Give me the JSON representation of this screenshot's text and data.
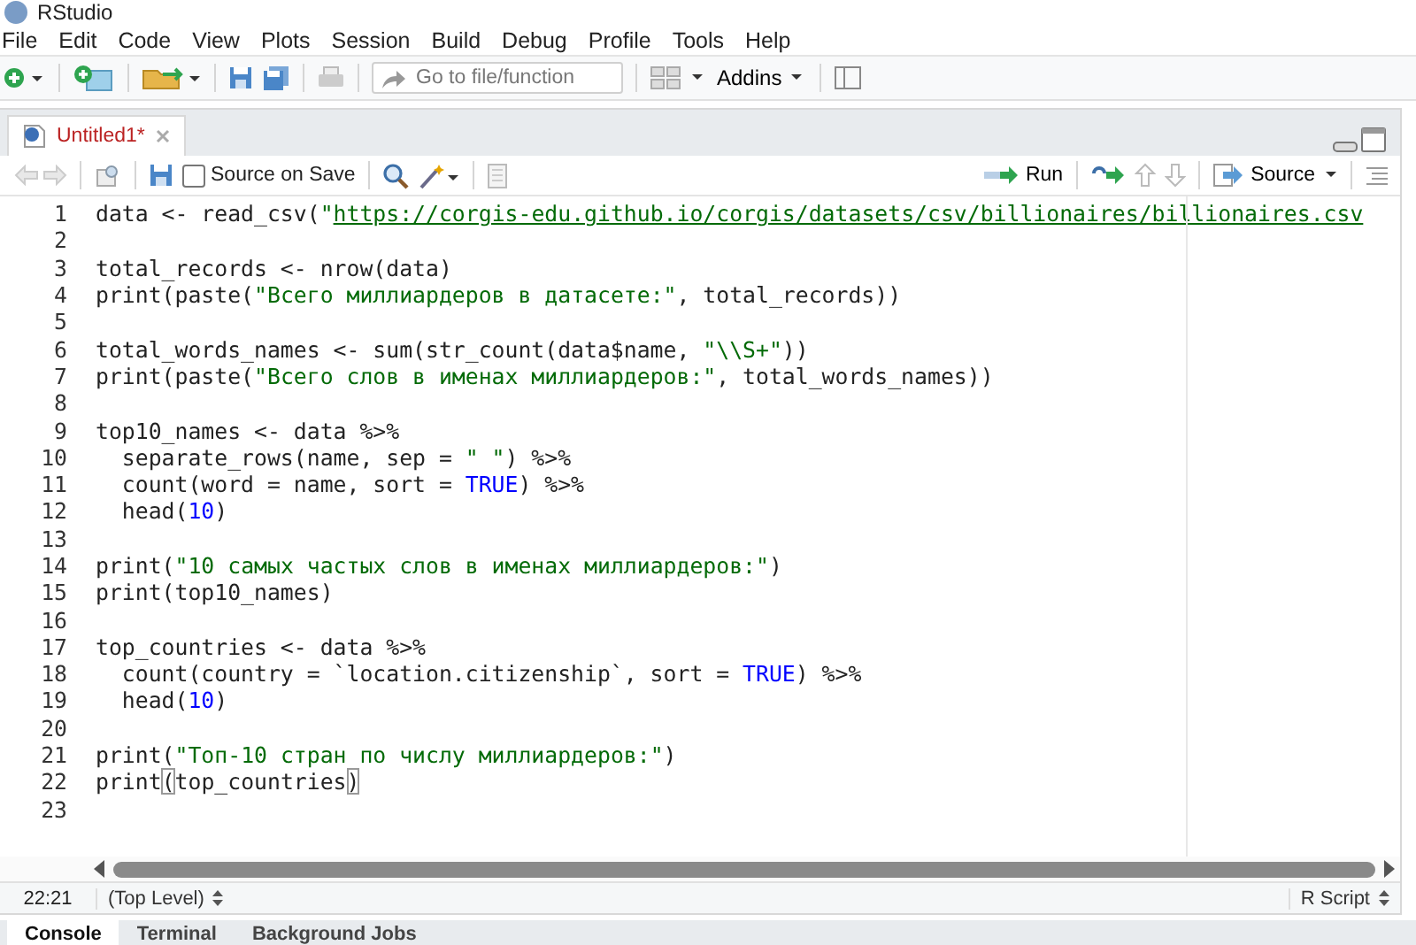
{
  "window": {
    "title": "RStudio"
  },
  "menu": [
    "File",
    "Edit",
    "Code",
    "View",
    "Plots",
    "Session",
    "Build",
    "Debug",
    "Profile",
    "Tools",
    "Help"
  ],
  "toolbar": {
    "goto": {
      "placeholder": "Go to file/function"
    },
    "addins": "Addins"
  },
  "editor_tabs": [
    {
      "label": "Untitled1*",
      "selected": true,
      "modified": true
    }
  ],
  "editor_toolbar": {
    "source_on_save": {
      "label": "Source on Save",
      "checked": false
    },
    "run": "Run",
    "source": "Source"
  },
  "lines": [
    {
      "number": "1",
      "tokens": [
        {
          "kind": "plain",
          "text": "data <- read_csv("
        },
        {
          "kind": "string",
          "text": "\""
        },
        {
          "kind": "link",
          "text": "https://corgis-edu.github.io/corgis/datasets/csv/billionaires/billionaires.csv"
        }
      ]
    },
    {
      "number": "2"
    },
    {
      "number": "3",
      "tokens": [
        {
          "kind": "plain",
          "text": "total_records <- nrow(data)"
        }
      ]
    },
    {
      "number": "4",
      "tokens": [
        {
          "kind": "plain",
          "text": "print(paste("
        },
        {
          "kind": "string",
          "text": "\"Всего миллиардеров в датасете:\""
        },
        {
          "kind": "plain",
          "text": ", total_records))"
        }
      ]
    },
    {
      "number": "5"
    },
    {
      "number": "6",
      "tokens": [
        {
          "kind": "plain",
          "text": "total_words_names <- sum(str_count(data$name, "
        },
        {
          "kind": "string",
          "text": "\"\\\\S+\""
        },
        {
          "kind": "plain",
          "text": "))"
        }
      ]
    },
    {
      "number": "7",
      "tokens": [
        {
          "kind": "plain",
          "text": "print(paste("
        },
        {
          "kind": "string",
          "text": "\"Всего слов в именах миллиардеров:\""
        },
        {
          "kind": "plain",
          "text": ", total_words_names))"
        }
      ]
    },
    {
      "number": "8"
    },
    {
      "number": "9",
      "tokens": [
        {
          "kind": "plain",
          "text": "top10_names <- data %>%"
        }
      ]
    },
    {
      "number": "10",
      "tokens": [
        {
          "kind": "plain",
          "text": "  separate_rows(name, sep = "
        },
        {
          "kind": "string",
          "text": "\" \""
        },
        {
          "kind": "plain",
          "text": ") %>%"
        }
      ]
    },
    {
      "number": "11",
      "tokens": [
        {
          "kind": "plain",
          "text": "  count(word = name, sort = "
        },
        {
          "kind": "constant",
          "text": "TRUE"
        },
        {
          "kind": "plain",
          "text": ") %>%"
        }
      ]
    },
    {
      "number": "12",
      "tokens": [
        {
          "kind": "plain",
          "text": "  head("
        },
        {
          "kind": "constant",
          "text": "10"
        },
        {
          "kind": "plain",
          "text": ")"
        }
      ]
    },
    {
      "number": "13"
    },
    {
      "number": "14",
      "tokens": [
        {
          "kind": "plain",
          "text": "print("
        },
        {
          "kind": "string",
          "text": "\"10 самых частых слов в именах миллиардеров:\""
        },
        {
          "kind": "plain",
          "text": ")"
        }
      ]
    },
    {
      "number": "15",
      "tokens": [
        {
          "kind": "plain",
          "text": "print(top10_names)"
        }
      ]
    },
    {
      "number": "16"
    },
    {
      "number": "17",
      "tokens": [
        {
          "kind": "plain",
          "text": "top_countries <- data %>%"
        }
      ]
    },
    {
      "number": "18",
      "tokens": [
        {
          "kind": "plain",
          "text": "  count(country = `location.citizenship`, sort = "
        },
        {
          "kind": "constant",
          "text": "TRUE"
        },
        {
          "kind": "plain",
          "text": ") %>%"
        }
      ]
    },
    {
      "number": "19",
      "tokens": [
        {
          "kind": "plain",
          "text": "  head("
        },
        {
          "kind": "constant",
          "text": "10"
        },
        {
          "kind": "plain",
          "text": ")"
        }
      ]
    },
    {
      "number": "20"
    },
    {
      "number": "21",
      "tokens": [
        {
          "kind": "plain",
          "text": "print("
        },
        {
          "kind": "string",
          "text": "\"Топ-10 стран по числу миллиардеров:\""
        },
        {
          "kind": "plain",
          "text": ")"
        }
      ]
    },
    {
      "number": "22",
      "tokens": [
        {
          "kind": "plain",
          "text": "print"
        },
        {
          "kind": "bracket",
          "text": "("
        },
        {
          "kind": "plain",
          "text": "top_countries"
        },
        {
          "kind": "bracket",
          "text": ")"
        }
      ]
    },
    {
      "number": "23"
    }
  ],
  "status_bar": {
    "position": "22:21",
    "scope": "(Top Level)",
    "file_type": "R Script"
  },
  "console_tabs": [
    {
      "label": "Console",
      "selected": true
    },
    {
      "label": "Terminal",
      "selected": false
    },
    {
      "label": "Background Jobs",
      "selected": false
    }
  ]
}
